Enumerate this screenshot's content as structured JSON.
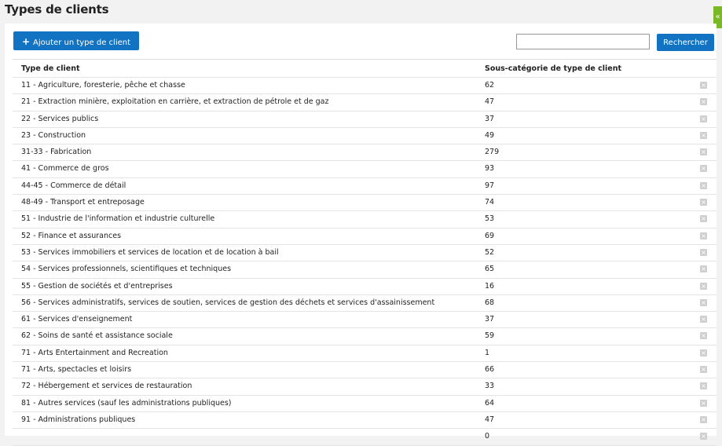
{
  "page": {
    "title": "Types de clients"
  },
  "toolbar": {
    "add_label": "Ajouter un type de client",
    "search_value": "",
    "search_label": "Rechercher"
  },
  "table": {
    "headers": [
      "Type de client",
      "Sous-catégorie de type de client"
    ],
    "rows": [
      {
        "type": "11 - Agriculture, foresterie, pêche et chasse",
        "count": "62"
      },
      {
        "type": "21 - Extraction minière, exploitation en carrière, et extraction de pétrole et de gaz",
        "count": "47"
      },
      {
        "type": "22 - Services publics",
        "count": "37"
      },
      {
        "type": "23 - Construction",
        "count": "49"
      },
      {
        "type": "31-33 - Fabrication",
        "count": "279"
      },
      {
        "type": "41 - Commerce de gros",
        "count": "93"
      },
      {
        "type": "44-45 - Commerce de détail",
        "count": "97"
      },
      {
        "type": "48-49 - Transport et entreposage",
        "count": "74"
      },
      {
        "type": "51 - Industrie de l'information et industrie culturelle",
        "count": "53"
      },
      {
        "type": "52 - Finance et assurances",
        "count": "69"
      },
      {
        "type": "53 - Services immobiliers et services de location et de location à bail",
        "count": "52"
      },
      {
        "type": "54 - Services professionnels, scientifiques et techniques",
        "count": "65"
      },
      {
        "type": "55 - Gestion de sociétés et d'entreprises",
        "count": "16"
      },
      {
        "type": "56 - Services administratifs, services de soutien, services de gestion des déchets et services d'assainissement",
        "count": "68"
      },
      {
        "type": "61 - Services d'enseignement",
        "count": "37"
      },
      {
        "type": "62 - Soins de santé et assistance sociale",
        "count": "59"
      },
      {
        "type": "71 - Arts Entertainment and Recreation",
        "count": "1"
      },
      {
        "type": "71 - Arts, spectacles et loisirs",
        "count": "66"
      },
      {
        "type": "72 - Hébergement et services de restauration",
        "count": "33"
      },
      {
        "type": "81 - Autres services (sauf les administrations publiques)",
        "count": "64"
      },
      {
        "type": "91 - Administrations publiques",
        "count": "47"
      },
      {
        "type": "",
        "count": "0"
      }
    ]
  },
  "icons": {
    "delete": "delete-icon",
    "collapse": "double-chevron-left-icon",
    "add": "plus-icon"
  },
  "colors": {
    "accent": "#1273c2",
    "side_tab": "#7ab828"
  }
}
